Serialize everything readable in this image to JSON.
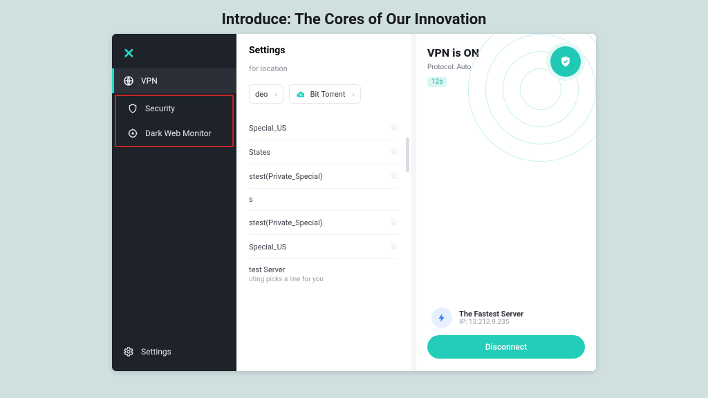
{
  "page": {
    "title": "Introduce: The Cores of Our Innovation"
  },
  "sidebar": {
    "items": [
      {
        "label": "VPN"
      },
      {
        "label": "Security"
      },
      {
        "label": "Dark Web Monitor"
      }
    ],
    "settings_label": "Settings"
  },
  "middle": {
    "header": "Settings",
    "search_placeholder": "for location",
    "chips": [
      {
        "label": "deo"
      },
      {
        "label": "Bit Torrent"
      }
    ],
    "list": [
      {
        "label": "Special_US"
      },
      {
        "label": "States"
      },
      {
        "label": "stest(Private_Special)"
      },
      {
        "label": "s"
      },
      {
        "label": "stest(Private_Special)"
      },
      {
        "label": "Special_US"
      },
      {
        "label": "test Server",
        "sub": "uting picks a line for you"
      }
    ]
  },
  "right": {
    "status_title": "VPN is ON",
    "protocol_label": "Protocol: Auto",
    "elapsed": "12s",
    "server": {
      "name": "The Fastest Server",
      "ip_label": "IP: 13.212.9.235"
    },
    "disconnect_label": "Disconnect"
  }
}
